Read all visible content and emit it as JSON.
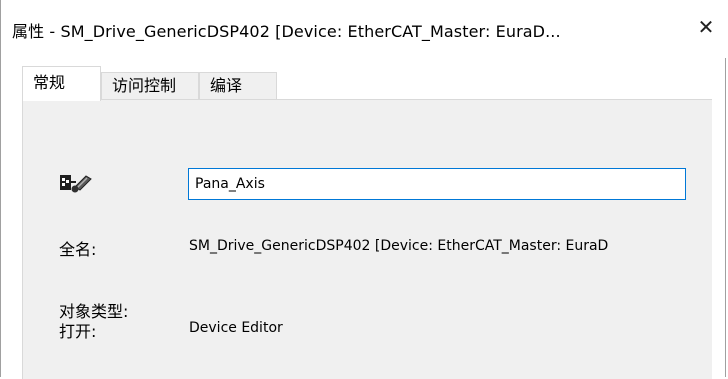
{
  "window": {
    "title": "属性 - SM_Drive_GenericDSP402 [Device: EtherCAT_Master: EuraD...",
    "close_glyph": "✕"
  },
  "tabs": [
    {
      "label": "常规",
      "active": true
    },
    {
      "label": "访问控制",
      "active": false
    },
    {
      "label": "编译",
      "active": false
    }
  ],
  "general": {
    "icon": "device-drive-icon",
    "name_value": "Pana_Axis",
    "fullname_label": "全名:",
    "fullname_value": "SM_Drive_GenericDSP402 [Device: EtherCAT_Master: EuraD",
    "object_type_label": "对象类型:",
    "open_label": "打开:",
    "open_value": "Device Editor"
  },
  "colors": {
    "panel_bg": "#f0f0f0",
    "input_border": "#0078d7",
    "tab_border": "#d9d9d9"
  }
}
